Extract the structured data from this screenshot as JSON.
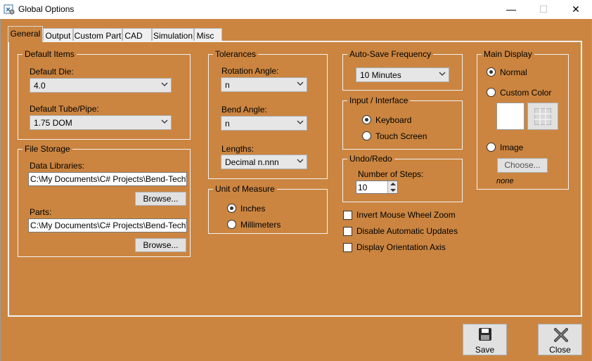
{
  "window": {
    "title": "Global Options",
    "minimize": "—",
    "maximize": "☐",
    "close": "✕"
  },
  "tabs": [
    "General",
    "Output",
    "Custom Part",
    "CAD",
    "Simulation",
    "Misc"
  ],
  "default_items": {
    "title": "Default Items",
    "die_label": "Default Die:",
    "die_value": "4.0",
    "tube_label": "Default Tube/Pipe:",
    "tube_value": "1.75 DOM"
  },
  "file_storage": {
    "title": "File Storage",
    "data_label": "Data Libraries:",
    "data_value": "C:\\My Documents\\C# Projects\\Bend-Tech\\Be",
    "browse1": "Browse...",
    "parts_label": "Parts:",
    "parts_value": "C:\\My Documents\\C# Projects\\Bend-Tech\\Be",
    "browse2": "Browse..."
  },
  "tolerances": {
    "title": "Tolerances",
    "rotation_label": "Rotation Angle:",
    "rotation_value": "n",
    "bend_label": "Bend Angle:",
    "bend_value": "n",
    "lengths_label": "Lengths:",
    "lengths_value": "Decimal n.nnn"
  },
  "unit": {
    "title": "Unit of Measure",
    "inches": "Inches",
    "mm": "Millimeters"
  },
  "autosave": {
    "title": "Auto-Save Frequency",
    "value": "10 Minutes"
  },
  "input": {
    "title": "Input / Interface",
    "keyboard": "Keyboard",
    "touch": "Touch Screen"
  },
  "undo": {
    "title": "Undo/Redo",
    "steps_label": "Number of Steps:",
    "steps_value": "10"
  },
  "checks": {
    "invert": "Invert Mouse Wheel Zoom",
    "disable": "Disable Automatic Updates",
    "display": "Display Orientation Axis"
  },
  "main_display": {
    "title": "Main Display",
    "normal": "Normal",
    "custom": "Custom Color",
    "image": "Image",
    "choose": "Choose...",
    "none": "none"
  },
  "footer": {
    "save": "Save",
    "close": "Close"
  }
}
